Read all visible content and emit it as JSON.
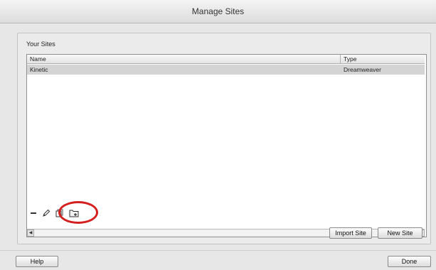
{
  "window": {
    "title": "Manage Sites"
  },
  "sites_panel": {
    "title": "Your Sites",
    "columns": {
      "name": "Name",
      "type": "Type"
    },
    "rows": [
      {
        "name": "Kinetic",
        "type": "Dreamweaver"
      }
    ],
    "scroll_left": "◀",
    "scroll_right": "▶"
  },
  "toolbar": {
    "icons": [
      "minus-icon",
      "pencil-icon",
      "duplicate-icon",
      "new-folder-icon"
    ]
  },
  "buttons": {
    "import_site": "Import Site",
    "new_site": "New Site",
    "help": "Help",
    "done": "Done"
  },
  "colors": {
    "highlight_circle": "#d41f1f",
    "selected_row": "#d4d4d4"
  }
}
